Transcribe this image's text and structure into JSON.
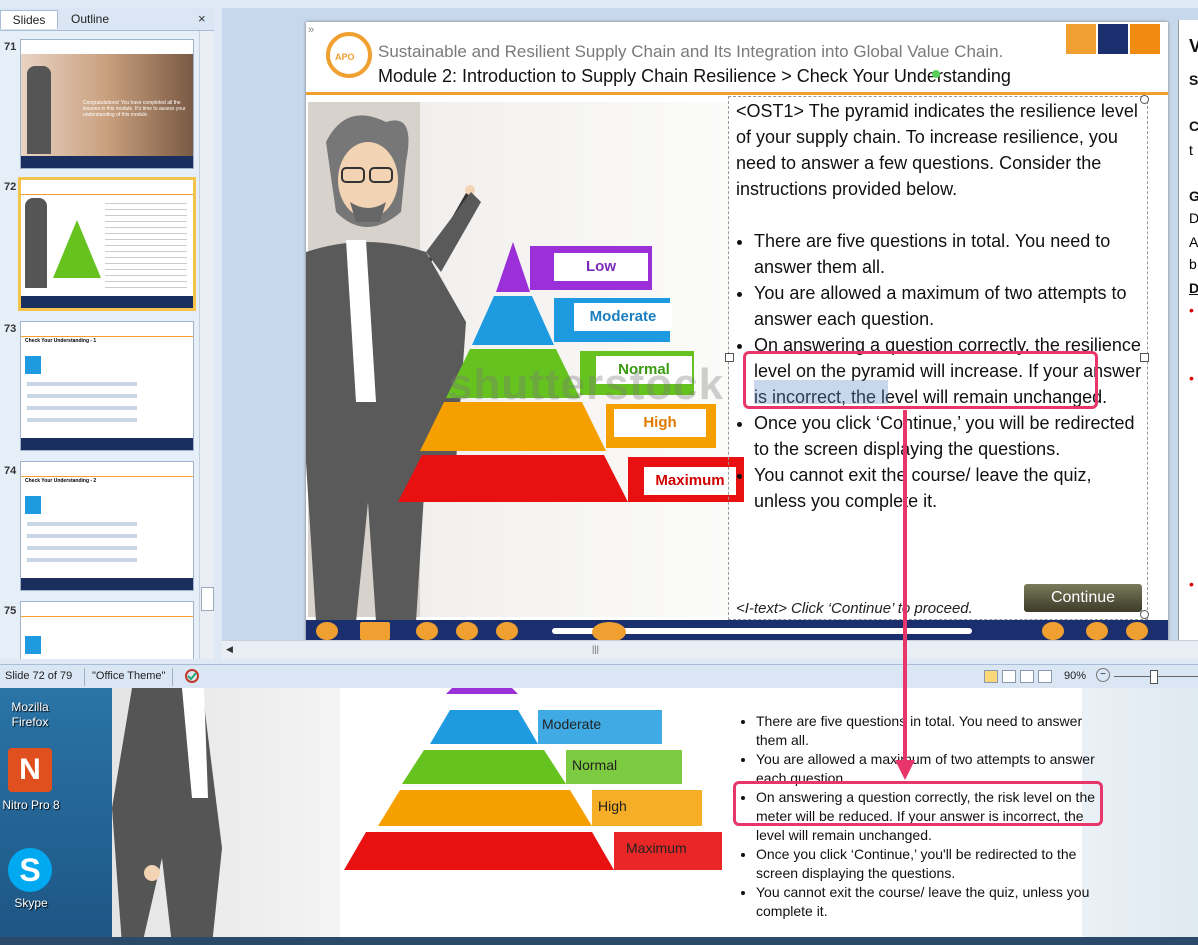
{
  "panel": {
    "tabs": [
      "Slides",
      "Outline"
    ],
    "close": "×",
    "slide_numbers": [
      "71",
      "72",
      "73",
      "74",
      "75"
    ],
    "thumb71_text": "Congratulations! You have completed all the lessons in this module. It's time to assess your understanding of this module.",
    "thumb73_title": "Check Your Understanding - 1",
    "thumb74_title": "Check Your Understanding - 2"
  },
  "slide": {
    "collapse_glyph": "»",
    "logo_text": "APO",
    "title": "Sustainable and Resilient Supply Chain and Its Integration into Global Value Chain.",
    "subtitle": "Module 2: Introduction to Supply Chain Resilience > Check Your Understanding",
    "intro": "<OST1> The pyramid indicates the resilience level of your supply chain. To increase resilience, you need to answer a few questions. Consider the instructions provided below.",
    "bullets": [
      "There are five questions in total. You need to answer them all.",
      "You are allowed a maximum of two attempts to answer each question.",
      "On answering a question correctly, the resilience level on the pyramid will increase. If your answer is incorrect, the level will remain unchanged.",
      "Once you click ‘Continue,’ you will be redirected to the screen displaying the questions.",
      "You cannot exit the course/ leave the quiz, unless you complete it."
    ],
    "itext": "<I-text> Click ‘Continue’ to proceed.",
    "continue_label": "Continue",
    "watermark": "shutterstock",
    "pyramid": {
      "levels": [
        {
          "label": "Low",
          "color": "#9b30d9",
          "text_color": "#7a2bb8"
        },
        {
          "label": "Moderate",
          "color": "#1e9be0",
          "text_color": "#1a7fc0"
        },
        {
          "label": "Normal",
          "color": "#66c21e",
          "text_color": "#3a9a10"
        },
        {
          "label": "High",
          "color": "#f5a000",
          "text_color": "#e07a00"
        },
        {
          "label": "Maximum",
          "color": "#e81010",
          "text_color": "#d00000"
        }
      ]
    }
  },
  "notes_panel": {
    "letters": [
      "V",
      "S",
      "C",
      "t",
      "G",
      "D",
      "A",
      "b",
      "D"
    ],
    "bullets": [
      "•",
      "•",
      "•"
    ]
  },
  "status_bar": {
    "slide_info": "Slide 72 of 79",
    "theme": "\"Office Theme\"",
    "zoom": "90%",
    "zoom_minus": "−",
    "scroll_left": "◀",
    "scroll_grip": "|||"
  },
  "desktop": {
    "icons": [
      "Mozilla Firefox",
      "Nitro Pro 8",
      "Skype"
    ],
    "nitro_glyph": "N",
    "skype_glyph": "S"
  },
  "screenshot2": {
    "pyramid": [
      {
        "label": "Moderate",
        "color": "#1e9be0"
      },
      {
        "label": "Normal",
        "color": "#66c21e"
      },
      {
        "label": "High",
        "color": "#f5a000"
      },
      {
        "label": "Maximum",
        "color": "#e81010"
      }
    ],
    "bullets": [
      "There are five questions in total. You need to answer them all.",
      "You are allowed a maximum of two attempts to answer each question.",
      "On answering a question correctly, the risk level on the meter will be reduced. If your answer is incorrect, the level will remain unchanged.",
      "Once you click ‘Continue,’ you'll be redirected to the screen displaying the questions.",
      "You cannot exit the course/ leave the quiz, unless you complete it."
    ]
  },
  "colors": {
    "highlight": "#e8356a",
    "accent_orange": "#f0a030",
    "nav_blue": "#1b2f6e"
  }
}
